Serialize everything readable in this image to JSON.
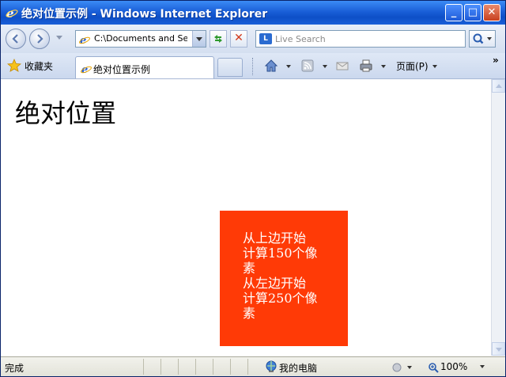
{
  "window": {
    "title": "绝对位置示例 - Windows Internet Explorer",
    "controls": {
      "minimize": "_",
      "maximize": "□",
      "close": "✕"
    }
  },
  "navbar": {
    "address": "C:\\Documents and Set",
    "search_placeholder": "Live Search",
    "search_logo": "L",
    "stop_glyph": "✕"
  },
  "favorites": {
    "label": "收藏夹",
    "tab_label": "绝对位置示例",
    "page_menu": "页面(P)",
    "more": "»"
  },
  "content": {
    "heading": "绝对位置",
    "box_lines": [
      "从上边开始",
      "计算150个像",
      "素",
      "从左边开始",
      "计算250个像",
      "素"
    ],
    "box_color": "#ff3a06"
  },
  "status": {
    "text": "完成",
    "zone": "我的电脑",
    "zoom": "100%"
  },
  "icons": [
    "ie-icon",
    "back-icon",
    "forward-icon",
    "refresh-icon",
    "stop-icon",
    "search-icon",
    "favorites-star-icon",
    "home-icon",
    "rss-icon",
    "mail-icon",
    "print-icon",
    "computer-icon",
    "protected-mode-icon",
    "zoom-icon"
  ]
}
